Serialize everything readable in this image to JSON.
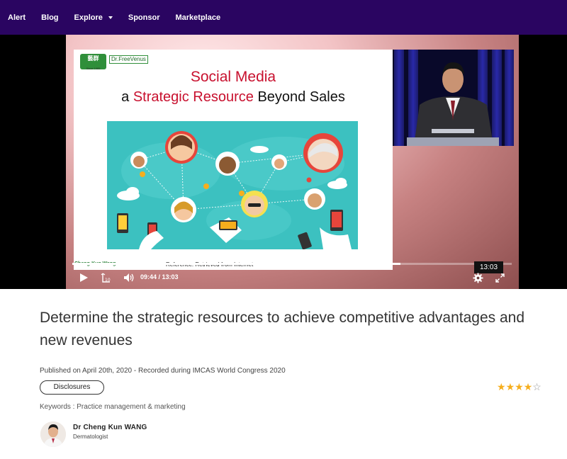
{
  "nav": {
    "items": [
      {
        "label": "Alert"
      },
      {
        "label": "Blog"
      },
      {
        "label": "Explore",
        "has_dropdown": true
      },
      {
        "label": "Sponsor"
      },
      {
        "label": "Marketplace"
      }
    ],
    "background": "#2a0561"
  },
  "player": {
    "slide": {
      "logo_chinese": "藝群",
      "logo_since": "Since 1985",
      "logo_brand": "Dr.FreeVenus",
      "title_line1": "Social Media",
      "title_line2_prefix": "a ",
      "title_line2_accent": "Strategic Resource",
      "title_line2_suffix": " Beyond Sales",
      "presenter_caption": "Cheng-Kun Wang",
      "reference": "Reference: Retrieved from Internet"
    },
    "current_time": "09:44",
    "duration": "13:03",
    "hover_time": "13:03",
    "progress_fraction": 0.746,
    "time_separator": " / "
  },
  "video": {
    "title": "Determine the strategic resources to achieve competitive advantages and new revenues",
    "published": "Published on April 20th, 2020 - Recorded during IMCAS World Congress 2020",
    "disclosures_label": "Disclosures",
    "keywords": "Keywords : Practice management & marketing",
    "rating": 4,
    "rating_max": 5,
    "rating_color": "#f6ae1d"
  },
  "speaker": {
    "name": "Dr Cheng Kun WANG",
    "role": "Dermatologist"
  }
}
